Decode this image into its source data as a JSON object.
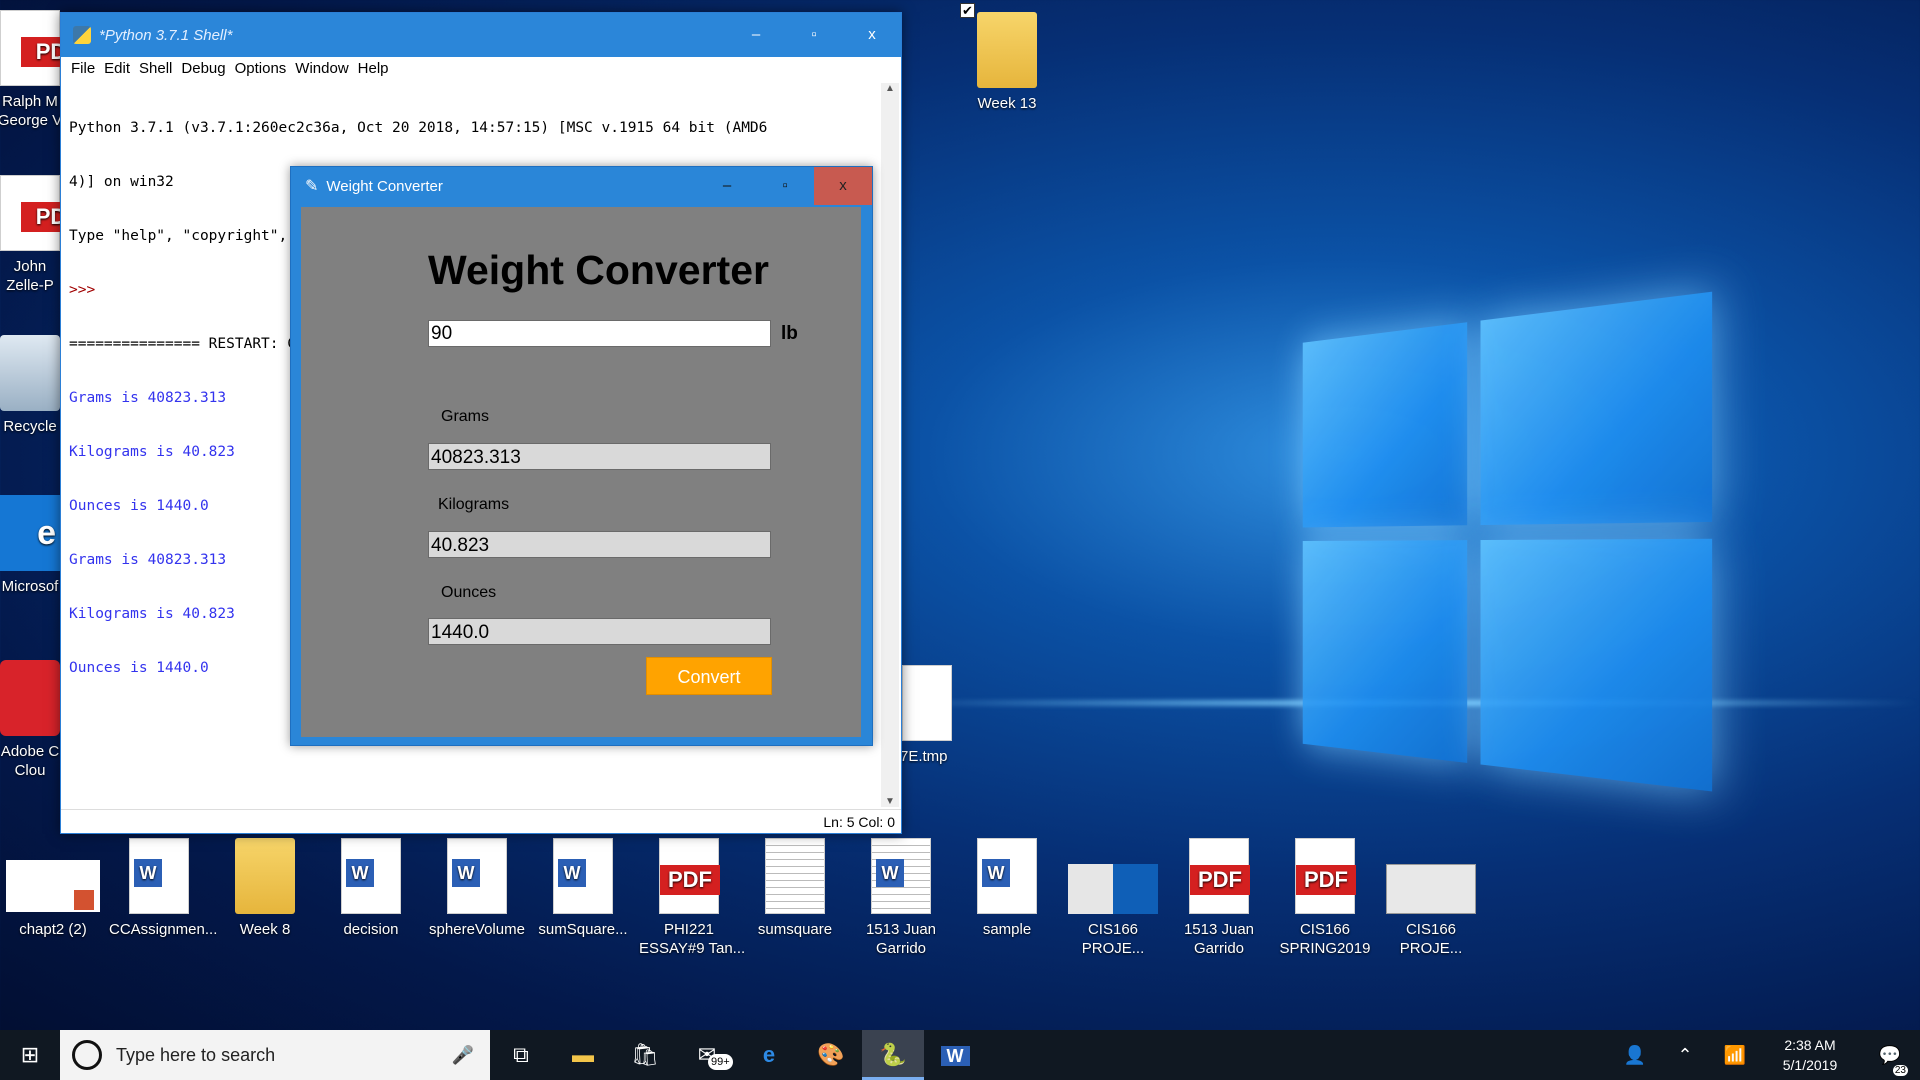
{
  "desktop": {
    "checkbox_mark": "✔",
    "left_icons": [
      {
        "label": "Ralph M\nGeorge V",
        "badge": "PD"
      },
      {
        "label": "John\nZelle-P",
        "badge": "PD"
      },
      {
        "label": "Recycle",
        "badge": ""
      },
      {
        "label": "Microsof",
        "badge": "e"
      },
      {
        "label": "Adobe C\nClou",
        "badge": ""
      }
    ],
    "top_icons": [
      {
        "label": "Week 13",
        "type": "folder"
      }
    ],
    "hidden_icon": {
      "label": "7E.tmp"
    },
    "bottom_icons": [
      {
        "label": "chapt2 (2)",
        "type": "ppt"
      },
      {
        "label": "CCAssignmen...",
        "type": "word"
      },
      {
        "label": "Week 8",
        "type": "folder"
      },
      {
        "label": "decision",
        "type": "word"
      },
      {
        "label": "sphereVolume",
        "type": "word"
      },
      {
        "label": "sumSquare...",
        "type": "word"
      },
      {
        "label": "PHI221\nESSAY#9 Tan...",
        "type": "pdf"
      },
      {
        "label": "sumsquare",
        "type": "text"
      },
      {
        "label": "1513 Juan\nGarrido",
        "type": "word-lines"
      },
      {
        "label": "sample",
        "type": "word"
      },
      {
        "label": "CIS166\nPROJE...",
        "type": "shot"
      },
      {
        "label": "1513 Juan\nGarrido",
        "type": "pdf"
      },
      {
        "label": "CIS166\nSPRING2019",
        "type": "pdf"
      },
      {
        "label": "CIS166\nPROJE...",
        "type": "shot"
      }
    ],
    "pdf_text": "PDF",
    "word_text": "W"
  },
  "shell": {
    "title": "*Python 3.7.1 Shell*",
    "menu": [
      "File",
      "Edit",
      "Shell",
      "Debug",
      "Options",
      "Window",
      "Help"
    ],
    "lines": [
      {
        "text": "Python 3.7.1 (v3.7.1:260ec2c36a, Oct 20 2018, 14:57:15) [MSC v.1915 64 bit (AMD6",
        "kind": "plain"
      },
      {
        "text": "4)] on win32",
        "kind": "plain"
      },
      {
        "text": "Type \"help\", \"copyright\", \"credits\" or \"license()\" for more information.",
        "kind": "plain"
      },
      {
        "text": ">>> ",
        "kind": "prompt"
      },
      {
        "text": "=============== RESTART: C:/Users/tanya/Desktop/wconverter.py ===============",
        "kind": "plain"
      },
      {
        "text": "Grams is 40823.313",
        "kind": "out"
      },
      {
        "text": "Kilograms is 40.823",
        "kind": "out"
      },
      {
        "text": "Ounces is 1440.0",
        "kind": "out"
      },
      {
        "text": "Grams is 40823.313",
        "kind": "out"
      },
      {
        "text": "Kilograms is 40.823",
        "kind": "out"
      },
      {
        "text": "Ounces is 1440.0",
        "kind": "out"
      }
    ],
    "status": "Ln: 5  Col: 0"
  },
  "converter": {
    "title": "Weight Converter",
    "heading": "Weight Converter",
    "input_value": "90",
    "unit": "lb",
    "grams_label": "Grams",
    "grams_value": "40823.313",
    "kilograms_label": "Kilograms",
    "kilograms_value": "40.823",
    "ounces_label": "Ounces",
    "ounces_value": "1440.0",
    "convert_label": "Convert"
  },
  "window_controls": {
    "minimize": "–",
    "maximize": "▫",
    "close": "x"
  },
  "taskbar": {
    "search_placeholder": "Type here to search",
    "mail_badge": "99+",
    "time": "2:38 AM",
    "date": "5/1/2019",
    "notification_count": "23"
  },
  "colors": {
    "convert_button": "#ffa300",
    "titlebar": "#2b86d9",
    "shell_output": "#3333ee",
    "shell_prompt": "#a00000"
  }
}
